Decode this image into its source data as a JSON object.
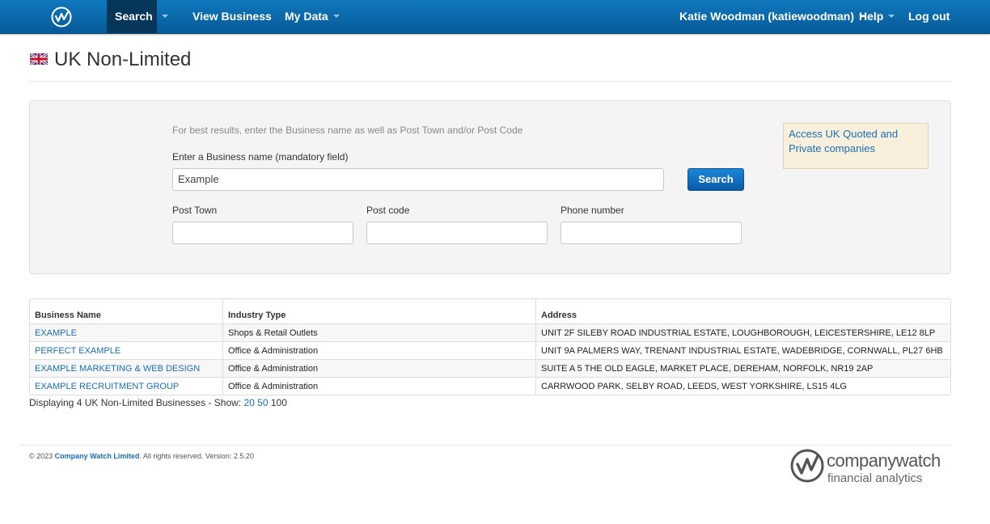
{
  "nav": {
    "search": "Search",
    "view_business": "View Business",
    "my_data": "My Data",
    "user": "Katie Woodman (katiewoodman)",
    "help": "Help",
    "logout": "Log out"
  },
  "page": {
    "title": "UK Non-Limited"
  },
  "search": {
    "hint": "For best results, enter the Business name as well as Post Town and/or Post Code",
    "business_label": "Enter a Business name (mandatory field)",
    "business_value": "Example",
    "button": "Search",
    "post_town_label": "Post Town",
    "post_code_label": "Post code",
    "phone_label": "Phone number",
    "access_link": "Access UK Quoted and Private companies"
  },
  "table": {
    "headers": [
      "Business Name",
      "Industry Type",
      "Address"
    ],
    "rows": [
      [
        "EXAMPLE",
        "Shops & Retail Outlets",
        "UNIT 2F SILEBY ROAD INDUSTRIAL ESTATE, LOUGHBOROUGH, LEICESTERSHIRE, LE12 8LP"
      ],
      [
        "PERFECT EXAMPLE",
        "Office & Administration",
        "UNIT 9A PALMERS WAY, TRENANT INDUSTRIAL ESTATE, WADEBRIDGE, CORNWALL, PL27 6HB"
      ],
      [
        "EXAMPLE MARKETING & WEB DESIGN",
        "Office & Administration",
        "SUITE A 5 THE OLD EAGLE, MARKET PLACE, DEREHAM, NORFOLK, NR19 2AP"
      ],
      [
        "EXAMPLE RECRUITMENT GROUP",
        "Office & Administration",
        "CARRWOOD PARK, SELBY ROAD, LEEDS, WEST YORKSHIRE, LS15 4LG"
      ]
    ]
  },
  "results": {
    "summary": "Displaying 4 UK Non-Limited Businesses - Show:",
    "show_20": "20",
    "show_50": "50",
    "show_100": "100"
  },
  "footer": {
    "copy_prefix": "© 2023",
    "company": "Company Watch Limited",
    "copy_suffix": ". All rights reserved. Version: 2.5.20",
    "brand_name": "companywatch",
    "brand_tag": "financial analytics"
  },
  "colors": {
    "nav_bg": "#0b69ad",
    "link": "#1a6fb8",
    "access_bg": "#f8f0dc"
  },
  "icons": {
    "logo": "companywatch-logo-icon",
    "flag": "uk-flag-icon",
    "caret": "caret-down-icon"
  }
}
